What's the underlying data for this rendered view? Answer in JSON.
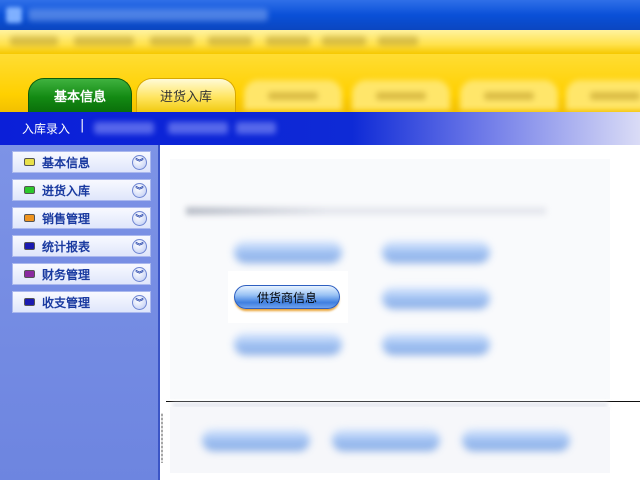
{
  "tabs": [
    {
      "label": "基本信息",
      "active": true
    },
    {
      "label": "进货入库",
      "active": false
    }
  ],
  "subbar": {
    "link_label": "入库录入",
    "separator": "|"
  },
  "sidebar": {
    "items": [
      {
        "label": "基本信息",
        "color": "#e8e04a"
      },
      {
        "label": "进货入库",
        "color": "#2cc82c"
      },
      {
        "label": "销售管理",
        "color": "#f0941e"
      },
      {
        "label": "统计报表",
        "color": "#1a1ab0"
      },
      {
        "label": "财务管理",
        "color": "#8a2aa0"
      },
      {
        "label": "收支管理",
        "color": "#1a1ab0"
      }
    ],
    "expand_icon": "double-chevron-down-icon"
  },
  "main": {
    "supplier_button_label": "供货商信息"
  },
  "colors": {
    "tab_active": "#138a13",
    "sidebar_bg": "#7d93e6",
    "subbar_bg": "#0e2ad6",
    "menubar_bg": "#ffe24d"
  }
}
